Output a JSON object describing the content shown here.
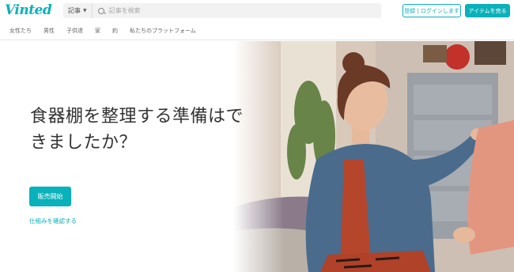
{
  "header": {
    "logo": "Vinted",
    "search": {
      "category": "記事",
      "placeholder": "記事を検索"
    },
    "login_label": "登録 | ログインします",
    "sell_label": "アイテムを売る"
  },
  "nav": {
    "items": [
      {
        "label": "女性たち"
      },
      {
        "label": "男性"
      },
      {
        "label": "子供達"
      },
      {
        "label": "家"
      },
      {
        "label": "約"
      },
      {
        "label": "私たちのプラットフォーム"
      }
    ]
  },
  "hero": {
    "title": "食器棚を整理する準備はできましたか？",
    "sell_button": "販売開始",
    "how_link": "仕組みを確認する"
  },
  "colors": {
    "brand": "#09b1ba"
  }
}
